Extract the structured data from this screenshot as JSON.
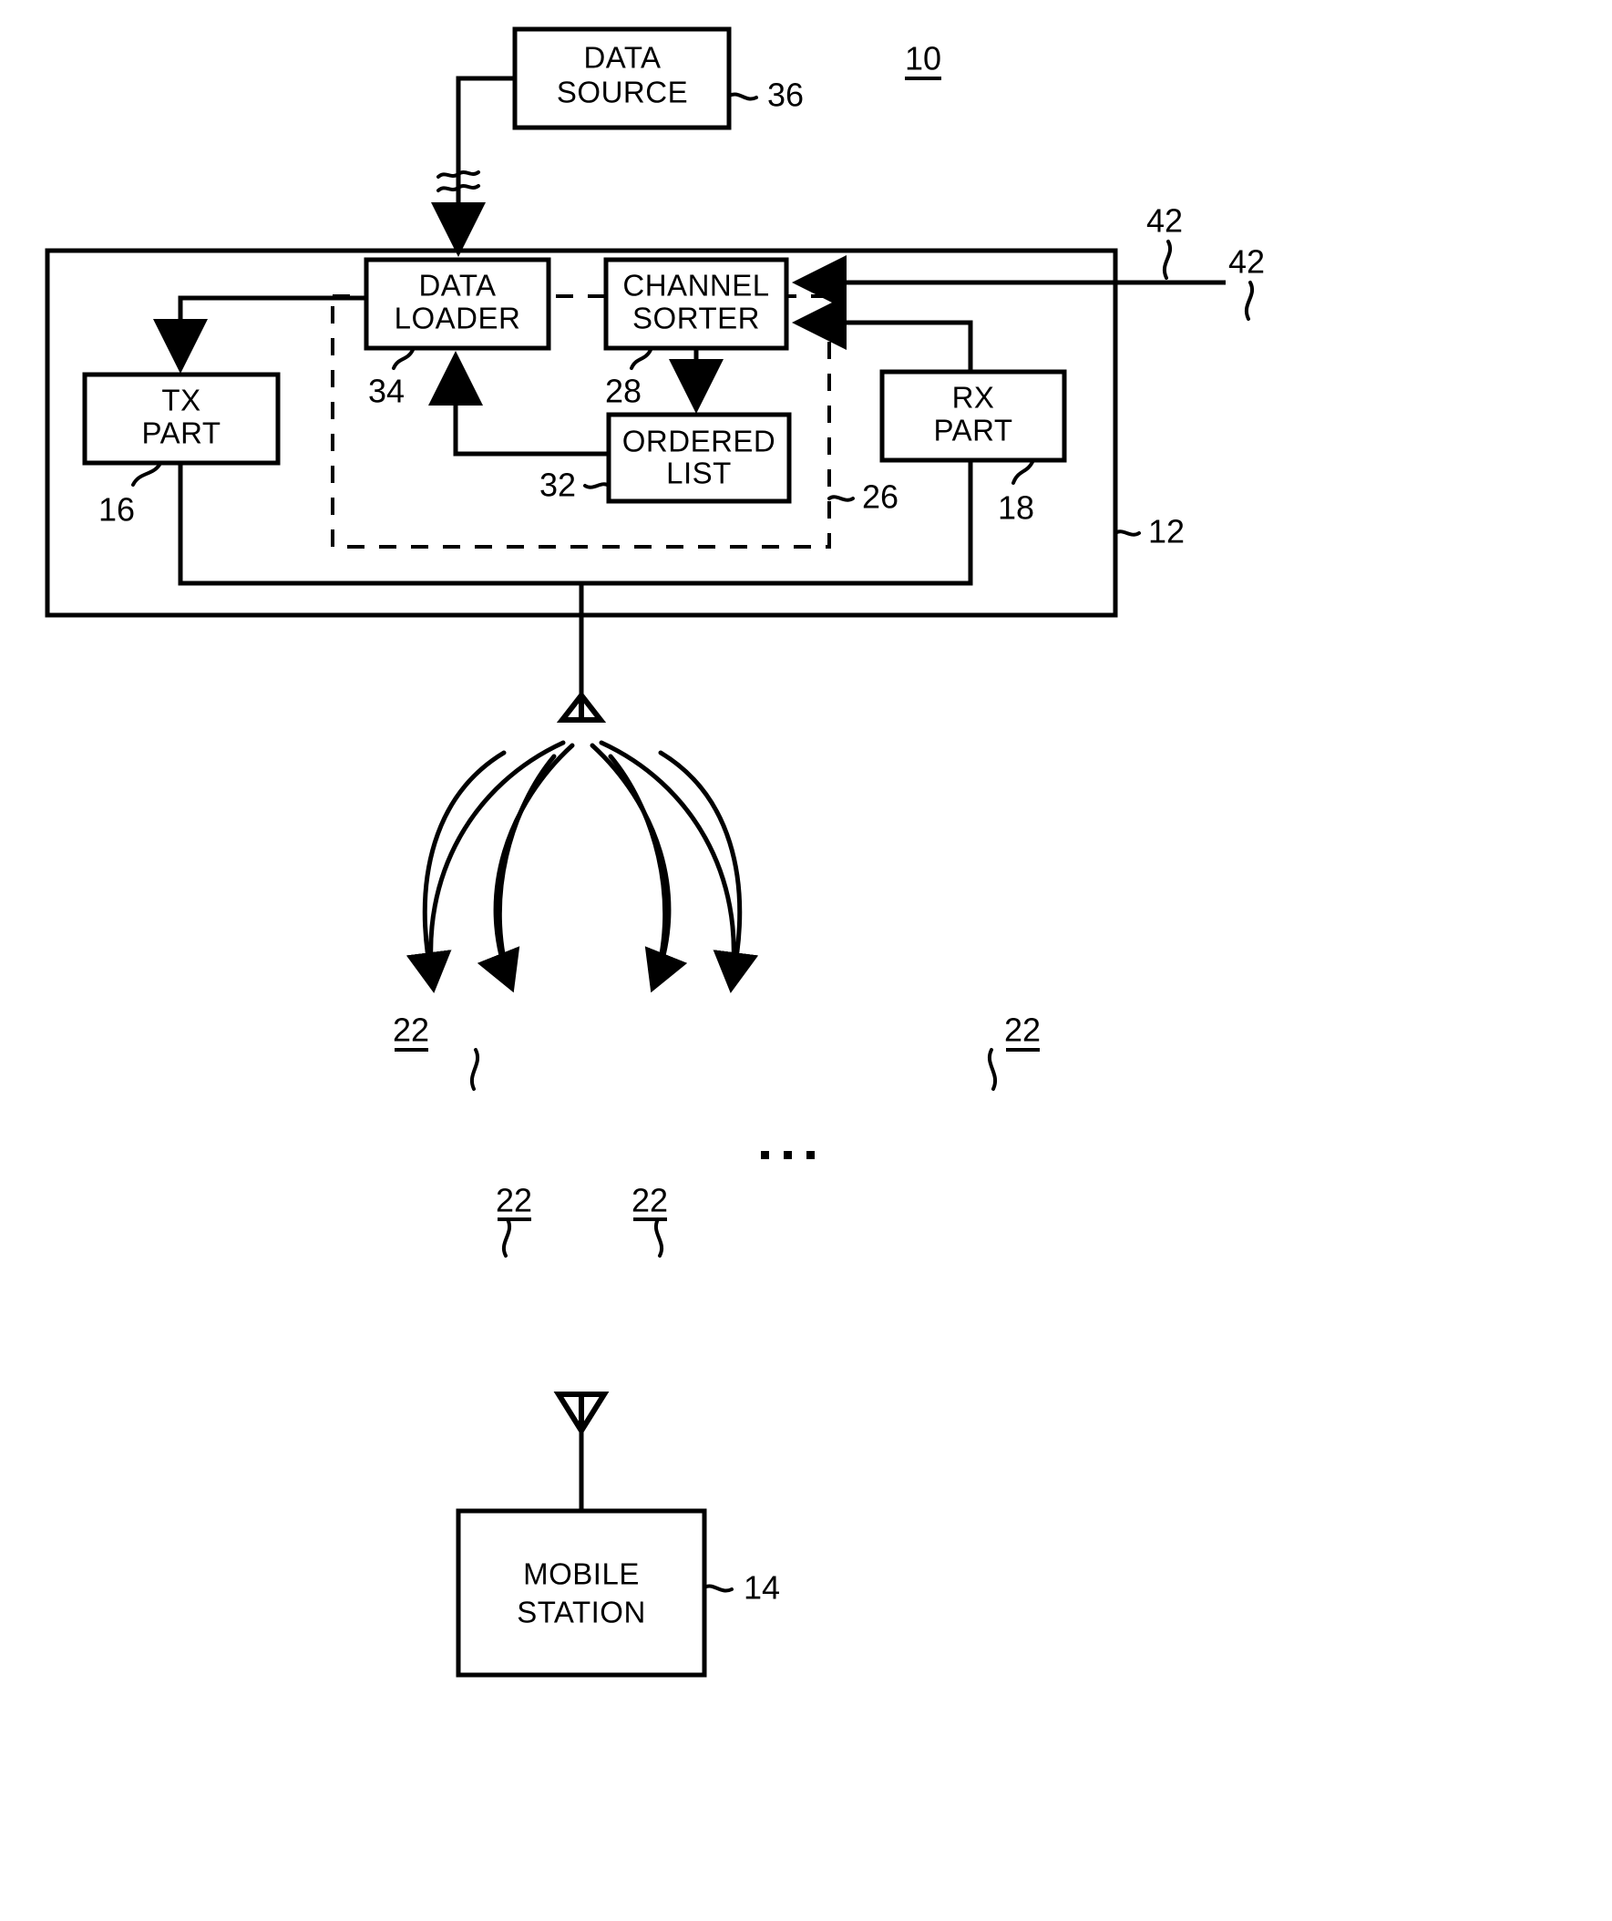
{
  "figure": {
    "figure_number": "10",
    "blocks": [
      {
        "id": "data_source",
        "label_line1": "DATA",
        "label_line2": "SOURCE",
        "ref": "36"
      },
      {
        "id": "data_loader",
        "label_line1": "DATA",
        "label_line2": "LOADER",
        "ref": "34"
      },
      {
        "id": "channel_sorter",
        "label_line1": "CHANNEL",
        "label_line2": "SORTER",
        "ref": "28"
      },
      {
        "id": "ordered_list",
        "label_line1": "ORDERED",
        "label_line2": "LIST",
        "ref": "32"
      },
      {
        "id": "tx_part",
        "label_line1": "TX",
        "label_line2": "PART",
        "ref": "16"
      },
      {
        "id": "rx_part",
        "label_line1": "RX",
        "label_line2": "PART",
        "ref": "18"
      },
      {
        "id": "mobile_station",
        "label_line1": "MOBILE",
        "label_line2": "STATION",
        "ref": "14"
      }
    ],
    "reference_numerals": {
      "system": "10",
      "base_station": "12",
      "mobile_station": "14",
      "tx_part": "16",
      "rx_part": "18",
      "beam_1": "22",
      "beam_2": "22",
      "beam_3": "22",
      "beam_4": "22",
      "controller_dashed": "26",
      "channel_sorter": "28",
      "ordered_list": "32",
      "data_loader": "34",
      "data_source": "36",
      "feedback_1": "42",
      "feedback_2": "42"
    },
    "ellipsis": "· · ·",
    "colors": {
      "ink": "#000000",
      "paper": "#ffffff"
    }
  }
}
